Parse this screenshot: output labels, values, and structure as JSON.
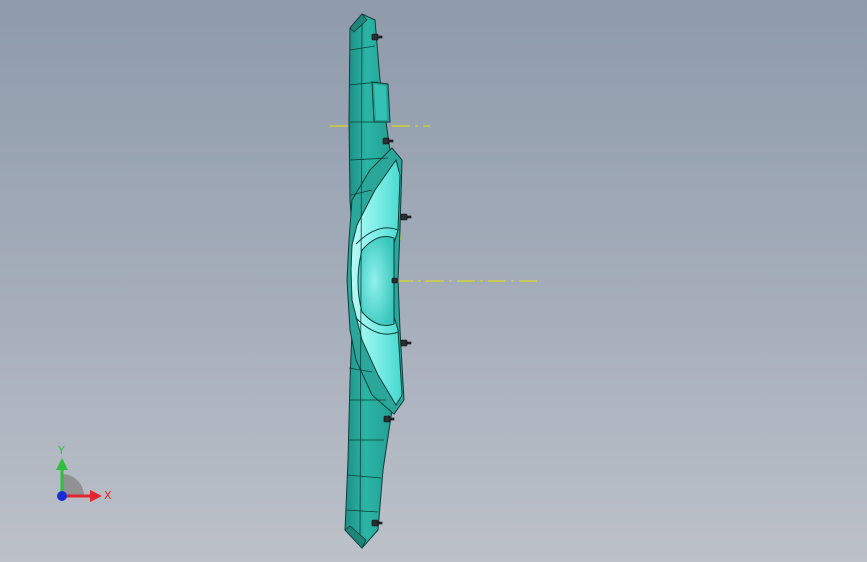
{
  "viewport": {
    "background_top": "#8e9bab",
    "background_bottom": "#bcc1c9"
  },
  "model": {
    "body_color": "#2bb5a6",
    "highlight_color": "#8ff2ec",
    "edge_color": "#0c3c3a",
    "centerline_color": "#e6e600"
  },
  "triad": {
    "x_label": "X",
    "y_label": "Y",
    "x_color": "#e3262b",
    "y_color": "#2fbf3f",
    "z_color": "#1b2bd6"
  }
}
